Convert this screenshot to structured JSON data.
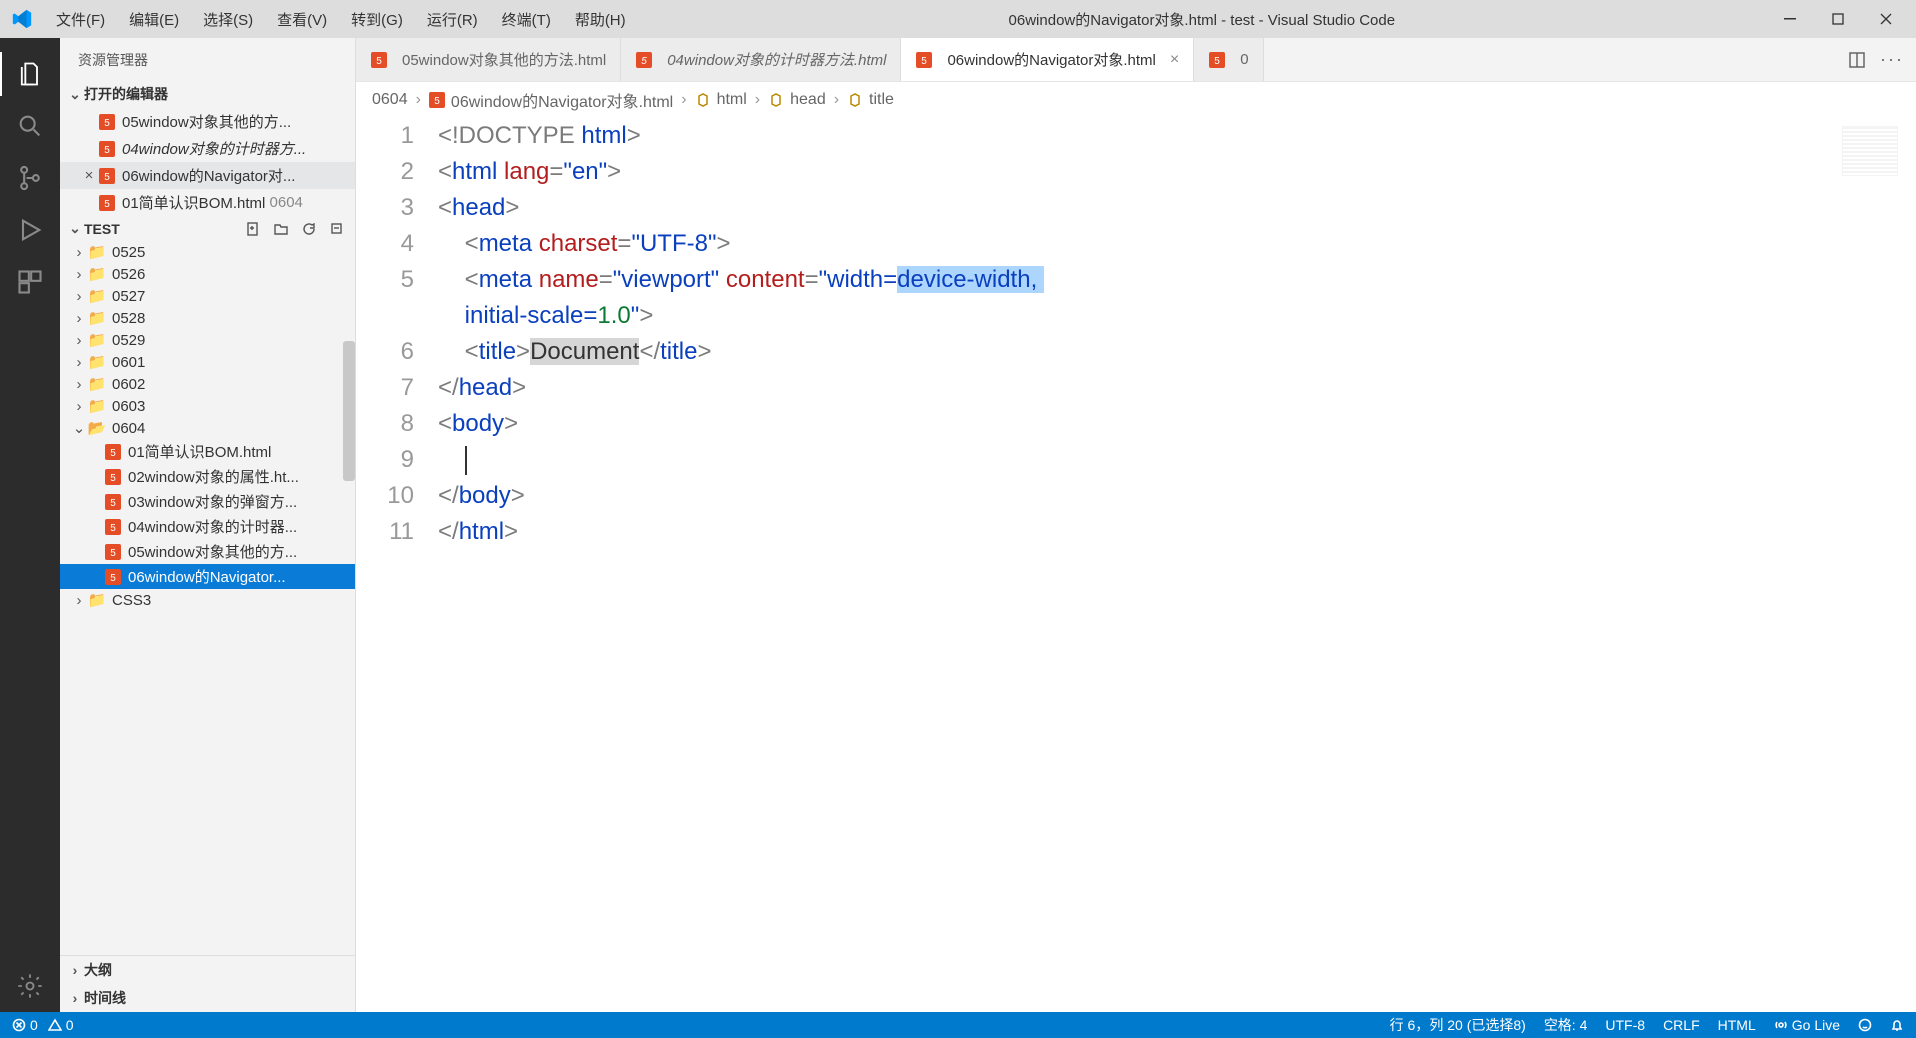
{
  "menu": [
    "文件(F)",
    "编辑(E)",
    "选择(S)",
    "查看(V)",
    "转到(G)",
    "运行(R)",
    "终端(T)",
    "帮助(H)"
  ],
  "title": "06window的Navigator对象.html - test - Visual Studio Code",
  "sidebar": {
    "title": "资源管理器",
    "openEditorsHeader": "打开的编辑器",
    "openEditors": [
      {
        "name": "05window对象其他的方...",
        "active": false,
        "italic": false
      },
      {
        "name": "04window对象的计时器方...",
        "active": false,
        "italic": true
      },
      {
        "name": "06window的Navigator对...",
        "active": true,
        "italic": false
      },
      {
        "name": "01简单认识BOM.html",
        "suffix": "0604",
        "active": false,
        "italic": false
      }
    ],
    "treeHeader": "TEST",
    "folders": [
      "0525",
      "0526",
      "0527",
      "0528",
      "0529",
      "0601",
      "0602",
      "0603"
    ],
    "openFolder": "0604",
    "openFolderFiles": [
      "01简单认识BOM.html",
      "02window对象的属性.ht...",
      "03window对象的弹窗方...",
      "04window对象的计时器...",
      "05window对象其他的方...",
      "06window的Navigator..."
    ],
    "afterFolder": "CSS3",
    "outline": "大纲",
    "timeline": "时间线"
  },
  "tabs": [
    {
      "label": "05window对象其他的方法.html",
      "italic": false,
      "active": false,
      "close": false
    },
    {
      "label": "04window对象的计时器方法.html",
      "italic": true,
      "active": false,
      "close": false
    },
    {
      "label": "06window的Navigator对象.html",
      "italic": false,
      "active": true,
      "close": true
    },
    {
      "label": "0",
      "italic": false,
      "active": false,
      "close": false
    }
  ],
  "breadcrumb": {
    "folder": "0604",
    "file": "06window的Navigator对象.html",
    "path": [
      "html",
      "head",
      "title"
    ]
  },
  "code": {
    "lines": [
      1,
      2,
      3,
      4,
      5,
      6,
      7,
      8,
      9,
      10,
      11
    ],
    "l1_doctype": "<!DOCTYPE ",
    "l1_html": "html",
    "l1_end": ">",
    "l2_open": "<",
    "l2_tag": "html",
    "l2_sp": " ",
    "l2_attr": "lang",
    "l2_eq": "=",
    "l2_val": "\"en\"",
    "l2_close": ">",
    "l3": "<head>",
    "l4_pre": "    <",
    "l4_tag": "meta",
    "l4_sp": " ",
    "l4_attr": "charset",
    "l4_eq": "=",
    "l4_val": "\"UTF-8\"",
    "l4_close": ">",
    "l5_pre": "    <",
    "l5_tag": "meta",
    "l5_sp": " ",
    "l5_attr1": "name",
    "l5_eq1": "=",
    "l5_val1": "\"viewport\"",
    "l5_sp2": " ",
    "l5_attr2": "content",
    "l5_eq2": "=",
    "l5_val2a": "\"width=",
    "l5_val2b": "device-width, ",
    "l5b_pre": "    ",
    "l5b_val": "initial-scale=",
    "l5b_num": "1.0",
    "l5b_end": "\"",
    "l5b_close": ">",
    "l6_pre": "    <",
    "l6_tag": "title",
    "l6_gt": ">",
    "l6_text": "Document",
    "l6_close": "</",
    "l6_tag2": "title",
    "l6_end": ">",
    "l7": "</head>",
    "l8": "<body>",
    "l9": "    ",
    "l10": "</body>",
    "l11": "</html>"
  },
  "status": {
    "errors": "0",
    "warnings": "0",
    "pos": "行 6，列 20 (已选择8)",
    "spaces": "空格: 4",
    "encoding": "UTF-8",
    "eol": "CRLF",
    "lang": "HTML",
    "golive": "Go Live"
  }
}
